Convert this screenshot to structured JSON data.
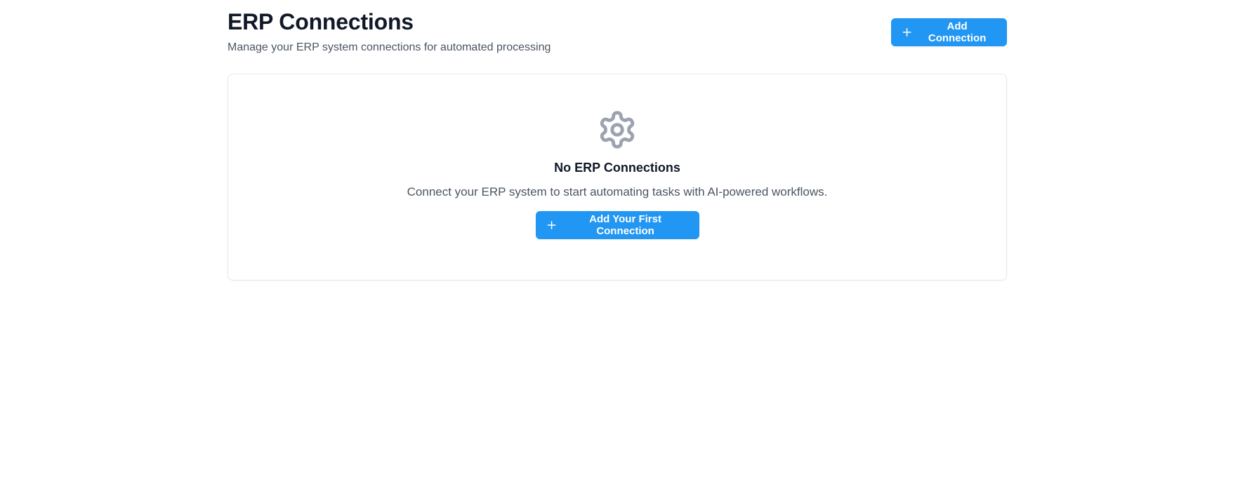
{
  "header": {
    "title": "ERP Connections",
    "subtitle": "Manage your ERP system connections for automated processing",
    "add_button_label": "Add Connection",
    "add_button_icon": "plus-icon"
  },
  "empty_state": {
    "icon": "gear-icon",
    "title": "No ERP Connections",
    "description": "Connect your ERP system to start automating tasks with AI-powered workflows.",
    "button_label": "Add Your First Connection",
    "button_icon": "plus-icon"
  },
  "colors": {
    "primary": "#2196f3",
    "heading": "#111827",
    "muted_text": "#4b5563",
    "icon_gray": "#9ca3af",
    "card_border": "#e5e7eb"
  }
}
